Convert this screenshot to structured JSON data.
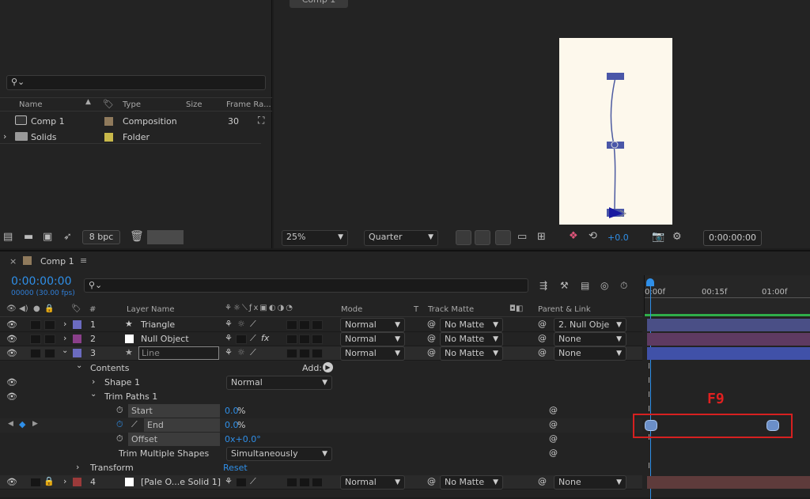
{
  "project": {
    "search_placeholder": "",
    "columns": {
      "name": "Name",
      "type": "Type",
      "size": "Size",
      "frame_rate": "Frame Ra..."
    },
    "items": [
      {
        "name": "Comp 1",
        "type": "Composition",
        "frame_rate": "30",
        "label_color": "#8f7a5c"
      },
      {
        "name": "Solids",
        "type": "Folder",
        "frame_rate": "",
        "label_color": "#c8b84a"
      }
    ],
    "bpc": "8 bpc"
  },
  "viewer": {
    "tab": "Comp 1",
    "zoom": "25%",
    "resolution": "Quarter",
    "exposure": "+0.0",
    "timecode": "0:00:00:00",
    "canvas_color": "#fdf8ec"
  },
  "timeline": {
    "tab": "Comp 1",
    "timecode": "0:00:00:00",
    "frame_info": "00000 (30.00 fps)",
    "columns": {
      "layer_name": "Layer Name",
      "mode": "Mode",
      "t": "T",
      "track_matte": "Track Matte",
      "parent": "Parent & Link",
      "num": "#"
    },
    "ruler": {
      "t0": "0:00f",
      "t1": "00:15f",
      "t2": "01:00f"
    },
    "layers": [
      {
        "num": "1",
        "name": "Triangle",
        "mode": "Normal",
        "matte": "No Matte",
        "parent": "2. Null Obje",
        "color": "#6b6bc0",
        "bar": "#4a4f86"
      },
      {
        "num": "2",
        "name": "Null Object",
        "mode": "Normal",
        "matte": "No Matte",
        "parent": "None",
        "color": "#8a3f8a",
        "bar": "#5e3a61"
      },
      {
        "num": "3",
        "name": "Line",
        "mode": "Normal",
        "matte": "No Matte",
        "parent": "None",
        "color": "#6b6bc0",
        "bar": "#4051a8"
      },
      {
        "num": "4",
        "name": "[Pale O...e Solid 1]",
        "mode": "Normal",
        "matte": "No Matte",
        "parent": "None",
        "color": "#9b3a3a",
        "bar": "#5e3b3b"
      }
    ],
    "contents": {
      "label": "Contents",
      "add_label": "Add:",
      "shape": "Shape 1",
      "shape_mode": "Normal",
      "trim": "Trim Paths 1",
      "start_label": "Start",
      "start_val": "0.0",
      "end_label": "End",
      "end_val": "0.0",
      "offset_label": "Offset",
      "offset_val": "0x+0.0°",
      "trim_multiple_label": "Trim Multiple Shapes",
      "trim_multiple_value": "Simultaneously",
      "transform": "Transform",
      "reset": "Reset",
      "percent": "%"
    },
    "annotation": "F9"
  }
}
